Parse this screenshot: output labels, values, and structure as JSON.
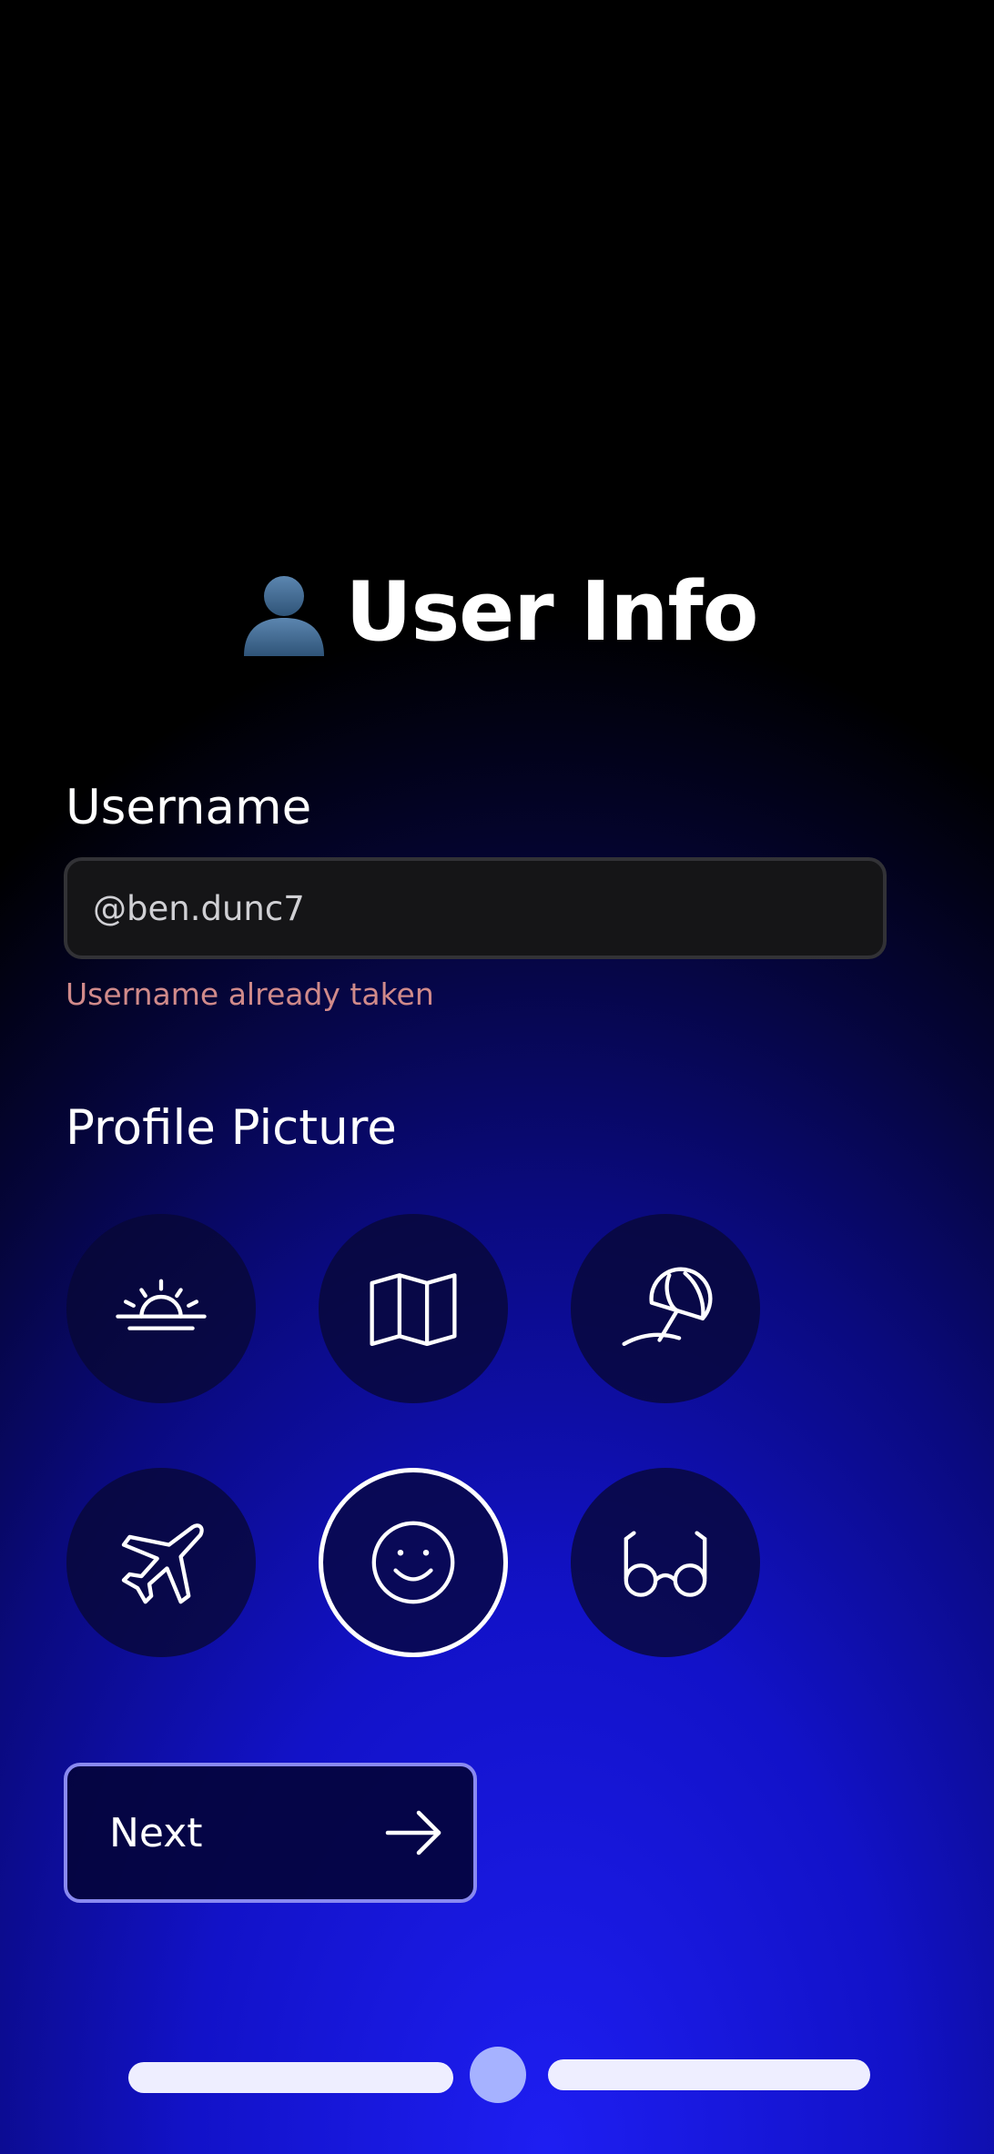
{
  "header": {
    "title": "User Info",
    "title_icon": "bust-in-silhouette-icon"
  },
  "username": {
    "label": "Username",
    "value": "@ben.dunc7",
    "error": "Username already taken",
    "error_color": "#d08a8a"
  },
  "profile_picture": {
    "label": "Profile Picture",
    "options": [
      {
        "icon": "sunrise-icon",
        "selected": false
      },
      {
        "icon": "map-icon",
        "selected": false
      },
      {
        "icon": "beach-umbrella-icon",
        "selected": false
      },
      {
        "icon": "airplane-icon",
        "selected": false
      },
      {
        "icon": "smiley-face-icon",
        "selected": true
      },
      {
        "icon": "glasses-icon",
        "selected": false
      }
    ]
  },
  "next_button": {
    "label": "Next",
    "icon": "arrow-right-icon",
    "border_color": "#8a8af0"
  },
  "progress": {
    "total_steps": 3,
    "current_step": 2,
    "active_color": "#a6b2ff"
  },
  "colors": {
    "background_top": "#000000",
    "background_bottom": "#1e1ef2"
  }
}
